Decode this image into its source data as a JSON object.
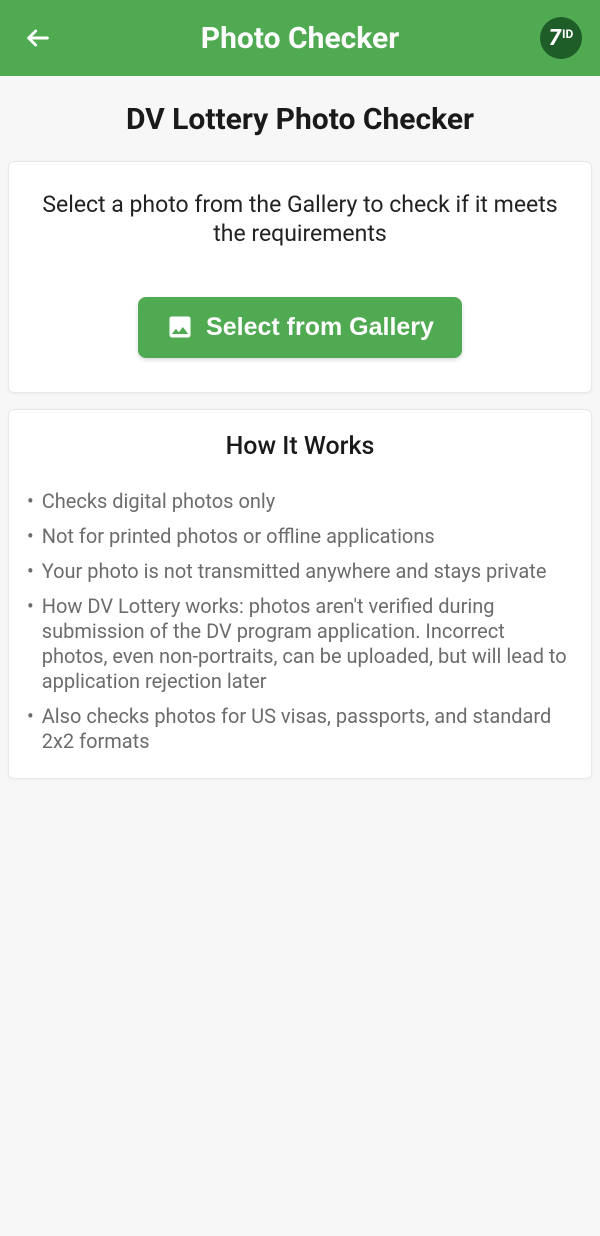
{
  "header": {
    "title": "Photo Checker",
    "logo": {
      "seven": "7",
      "id": "ID"
    }
  },
  "page": {
    "title": "DV Lottery Photo Checker"
  },
  "selection": {
    "instruction": "Select a photo from the Gallery to check if it meets the requirements",
    "button_label": "Select from Gallery"
  },
  "how_it_works": {
    "title": "How It Works",
    "items": [
      "Checks digital photos only",
      "Not for printed photos or offline applications",
      "Your photo is not transmitted anywhere and stays private",
      "How DV Lottery works: photos aren't verified during submission of the DV program application. Incorrect photos, even non-portraits, can be uploaded, but will lead to application rejection later",
      "Also checks photos for US visas, passports, and standard 2x2 formats"
    ]
  }
}
